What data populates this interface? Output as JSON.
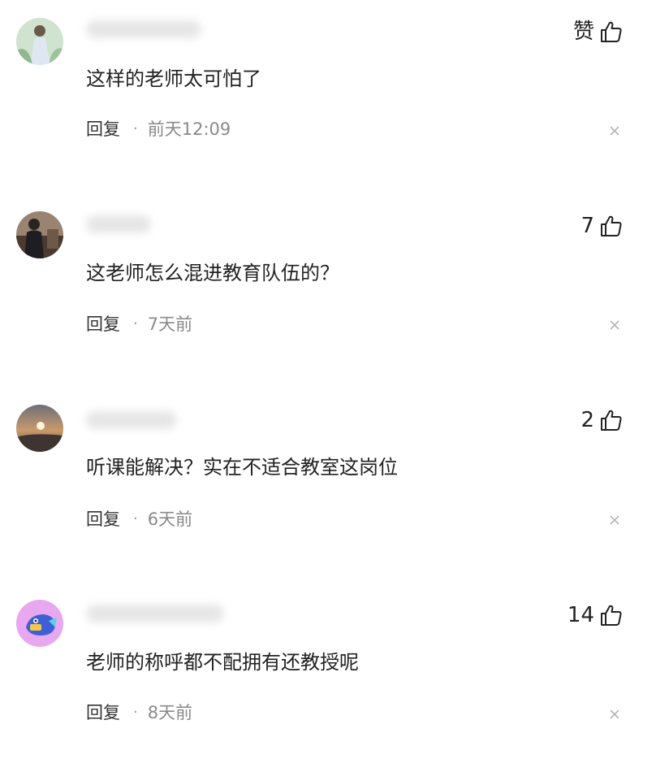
{
  "comments": [
    {
      "avatar_icon": "user-avatar-icon",
      "username": "",
      "like_label": "赞",
      "text": "这样的老师太可怕了",
      "reply_label": "回复",
      "separator": "·",
      "time": "前天12:09"
    },
    {
      "avatar_icon": "user-avatar-icon",
      "username": "",
      "like_label": "7",
      "text": "这老师怎么混进教育队伍的？",
      "reply_label": "回复",
      "separator": "·",
      "time": "7天前"
    },
    {
      "avatar_icon": "user-avatar-icon",
      "username": "",
      "like_label": "2",
      "text": "听课能解决？实在不适合教室这岗位",
      "reply_label": "回复",
      "separator": "·",
      "time": "6天前"
    },
    {
      "avatar_icon": "user-avatar-icon",
      "username": "",
      "like_label": "14",
      "text": "老师的称呼都不配拥有还教授呢",
      "reply_label": "回复",
      "separator": "·",
      "time": "8天前"
    }
  ],
  "icons": {
    "like": "thumbs-up-icon",
    "close": "close-icon"
  },
  "colors": {
    "text": "#222222",
    "meta": "#8a8a8a",
    "background": "#ffffff"
  }
}
